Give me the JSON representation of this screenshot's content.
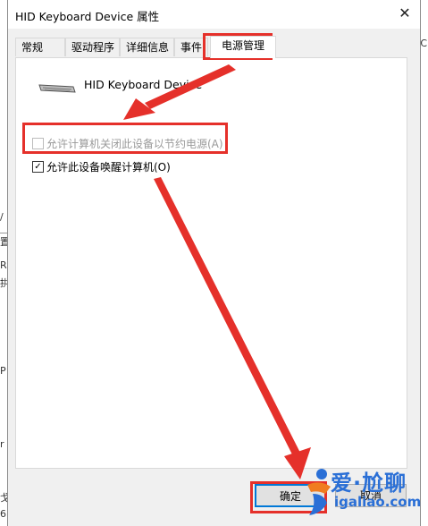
{
  "window": {
    "title": "HID Keyboard Device 属性"
  },
  "tabs": [
    {
      "label": "常规"
    },
    {
      "label": "驱动程序"
    },
    {
      "label": "详细信息"
    },
    {
      "label": "事件"
    },
    {
      "label": "电源管理",
      "active": true
    }
  ],
  "device": {
    "name": "HID Keyboard Device",
    "icon": "keyboard-icon"
  },
  "power": {
    "allow_turn_off": {
      "label": "允许计算机关闭此设备以节约电源(A)",
      "checked": false,
      "enabled": false
    },
    "allow_wake": {
      "label": "允许此设备唤醒计算机(O)",
      "checked": true,
      "enabled": true
    }
  },
  "buttons": {
    "ok": "确定",
    "cancel": "取消"
  },
  "background_fragments": {
    "left": [
      "/",
      "置",
      "R",
      "拱",
      "P",
      "r",
      "戈",
      "6"
    ],
    "right": [
      "C"
    ]
  },
  "watermark": {
    "text_cn": "爱·尬聊",
    "text_en": "igaliao.com"
  },
  "colors": {
    "annotation_red": "#e5302a",
    "accent_blue": "#0078d7",
    "watermark_blue": "#2a6fd6"
  }
}
